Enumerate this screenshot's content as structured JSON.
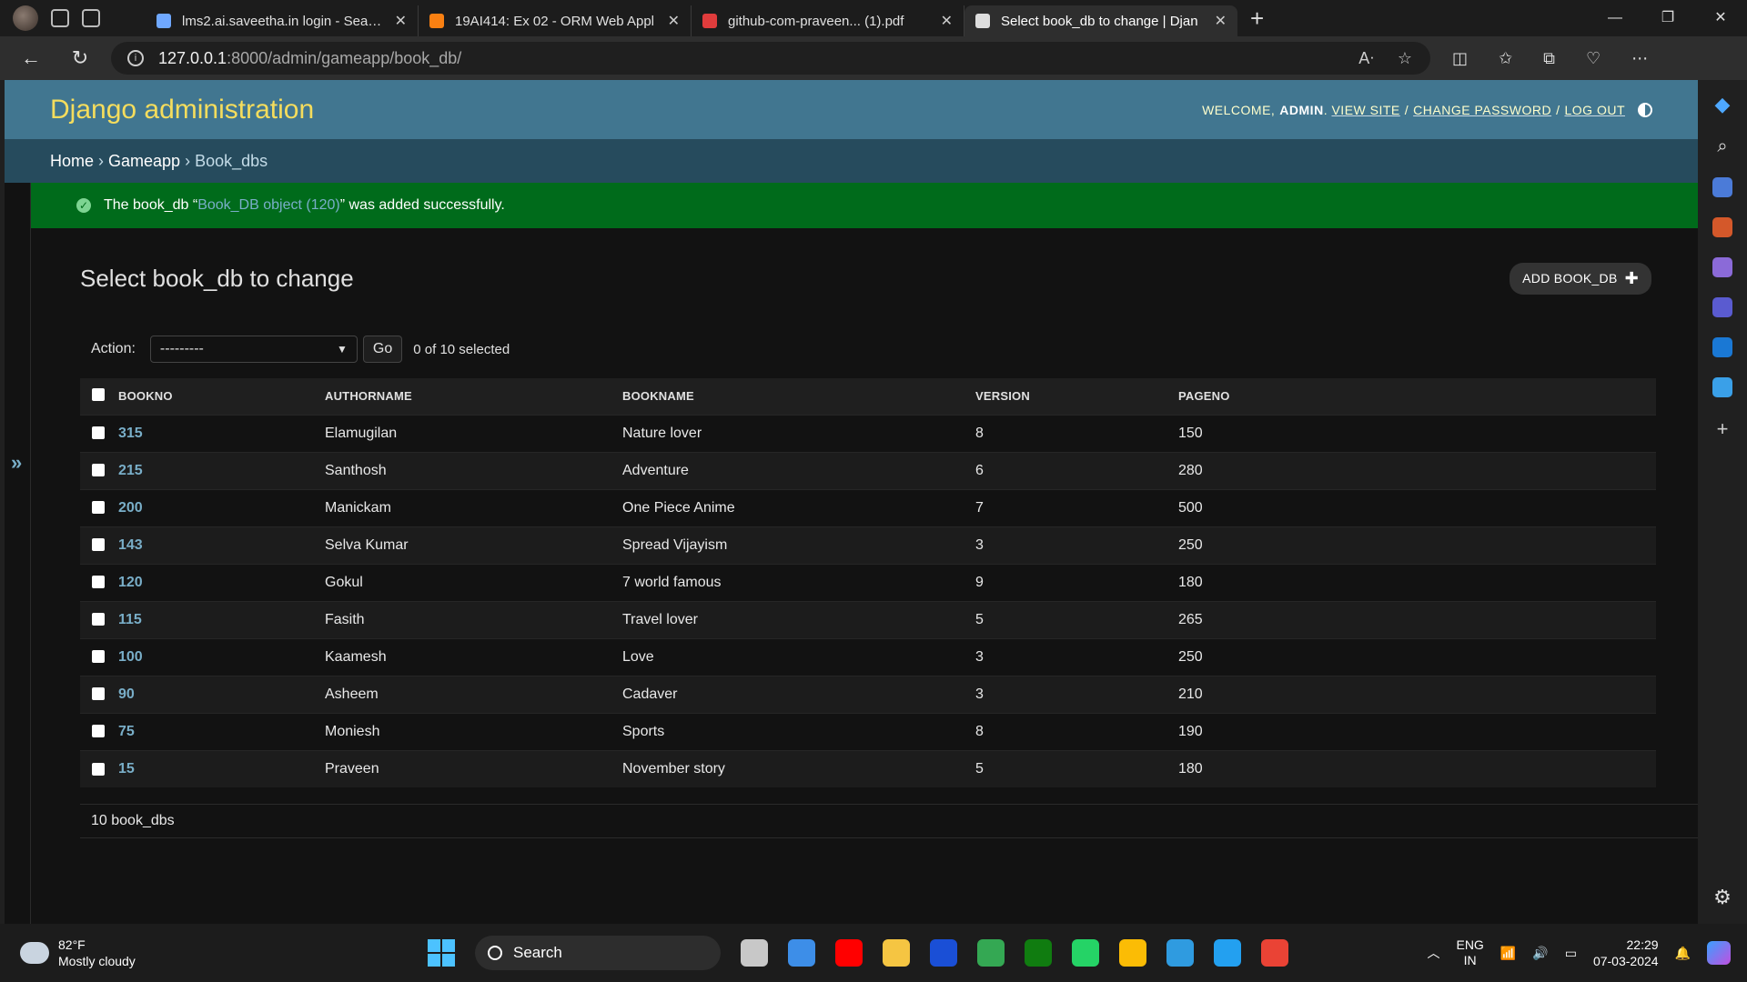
{
  "browser": {
    "tabs": [
      {
        "title": "lms2.ai.saveetha.in login - Search",
        "favicon": "search-icon",
        "color": "#6fa8ff",
        "active": false
      },
      {
        "title": "19AI414: Ex 02 - ORM Web Appl",
        "favicon": "moodle-icon",
        "color": "#f98012",
        "active": false
      },
      {
        "title": "github-com-praveen... (1).pdf",
        "favicon": "pdf-icon",
        "color": "#e03c3c",
        "active": false
      },
      {
        "title": "Select book_db to change | Djan",
        "favicon": "page-icon",
        "color": "#dddddd",
        "active": true
      }
    ],
    "url_host": "127.0.0.1",
    "url_path": ":8000/admin/gameapp/book_db/"
  },
  "admin": {
    "site_name": "Django administration",
    "welcome": "WELCOME,",
    "user": "ADMIN",
    "view_site": "VIEW SITE",
    "change_password": "CHANGE PASSWORD",
    "log_out": "LOG OUT",
    "slash": "/",
    "breadcrumbs": [
      "Home",
      "Gameapp",
      "Book_dbs"
    ],
    "breadcrumb_sep": "›",
    "sidebar_toggle": "»"
  },
  "message": {
    "prefix": "The book_db “",
    "link": "Book_DB object (120)",
    "suffix": "” was added successfully."
  },
  "content": {
    "title": "Select book_db to change",
    "add_button": "ADD BOOK_DB",
    "action_label": "Action:",
    "action_value": "---------",
    "go_label": "Go",
    "selected_count": "0 of 10 selected",
    "columns": [
      "BOOKNO",
      "AUTHORNAME",
      "BOOKNAME",
      "VERSION",
      "PAGENO"
    ],
    "rows": [
      {
        "bookno": "315",
        "author": "Elamugilan",
        "book": "Nature lover",
        "version": "8",
        "pageno": "150"
      },
      {
        "bookno": "215",
        "author": "Santhosh",
        "book": "Adventure",
        "version": "6",
        "pageno": "280"
      },
      {
        "bookno": "200",
        "author": "Manickam",
        "book": "One Piece Anime",
        "version": "7",
        "pageno": "500"
      },
      {
        "bookno": "143",
        "author": "Selva Kumar",
        "book": "Spread Vijayism",
        "version": "3",
        "pageno": "250"
      },
      {
        "bookno": "120",
        "author": "Gokul",
        "book": "7 world famous",
        "version": "9",
        "pageno": "180"
      },
      {
        "bookno": "115",
        "author": "Fasith",
        "book": "Travel lover",
        "version": "5",
        "pageno": "265"
      },
      {
        "bookno": "100",
        "author": "Kaamesh",
        "book": "Love",
        "version": "3",
        "pageno": "250"
      },
      {
        "bookno": "90",
        "author": "Asheem",
        "book": "Cadaver",
        "version": "3",
        "pageno": "210"
      },
      {
        "bookno": "75",
        "author": "Moniesh",
        "book": "Sports",
        "version": "8",
        "pageno": "190"
      },
      {
        "bookno": "15",
        "author": "Praveen",
        "book": "November story",
        "version": "5",
        "pageno": "180"
      }
    ],
    "paginator": "10 book_dbs"
  },
  "taskbar": {
    "temp": "82°F",
    "weather": "Mostly cloudy",
    "search": "Search",
    "lang1": "ENG",
    "lang2": "IN",
    "time": "22:29",
    "date": "07-03-2024",
    "apps": [
      {
        "name": "task-view-icon",
        "color": "#c8c8c8"
      },
      {
        "name": "store-icon",
        "color": "#3d8ee8"
      },
      {
        "name": "youtube-icon",
        "color": "#ff0000"
      },
      {
        "name": "file-explorer-icon",
        "color": "#f5c542"
      },
      {
        "name": "l-app-icon",
        "color": "#1a4fd6"
      },
      {
        "name": "chrome-icon",
        "color": "#34a853"
      },
      {
        "name": "xbox-icon",
        "color": "#107c10"
      },
      {
        "name": "whatsapp-icon",
        "color": "#25d366"
      },
      {
        "name": "chrome-profile-icon",
        "color": "#fbbc05"
      },
      {
        "name": "edge-icon",
        "color": "#2f9be0"
      },
      {
        "name": "vscode-icon",
        "color": "#23a0f0"
      },
      {
        "name": "chrome-profile2-icon",
        "color": "#ea4335"
      }
    ]
  },
  "colors": {
    "header": "#417690",
    "breadcrumbs": "#264b5d",
    "success": "#006b1b",
    "link": "#79aec8",
    "brand": "#f5dd5d"
  }
}
